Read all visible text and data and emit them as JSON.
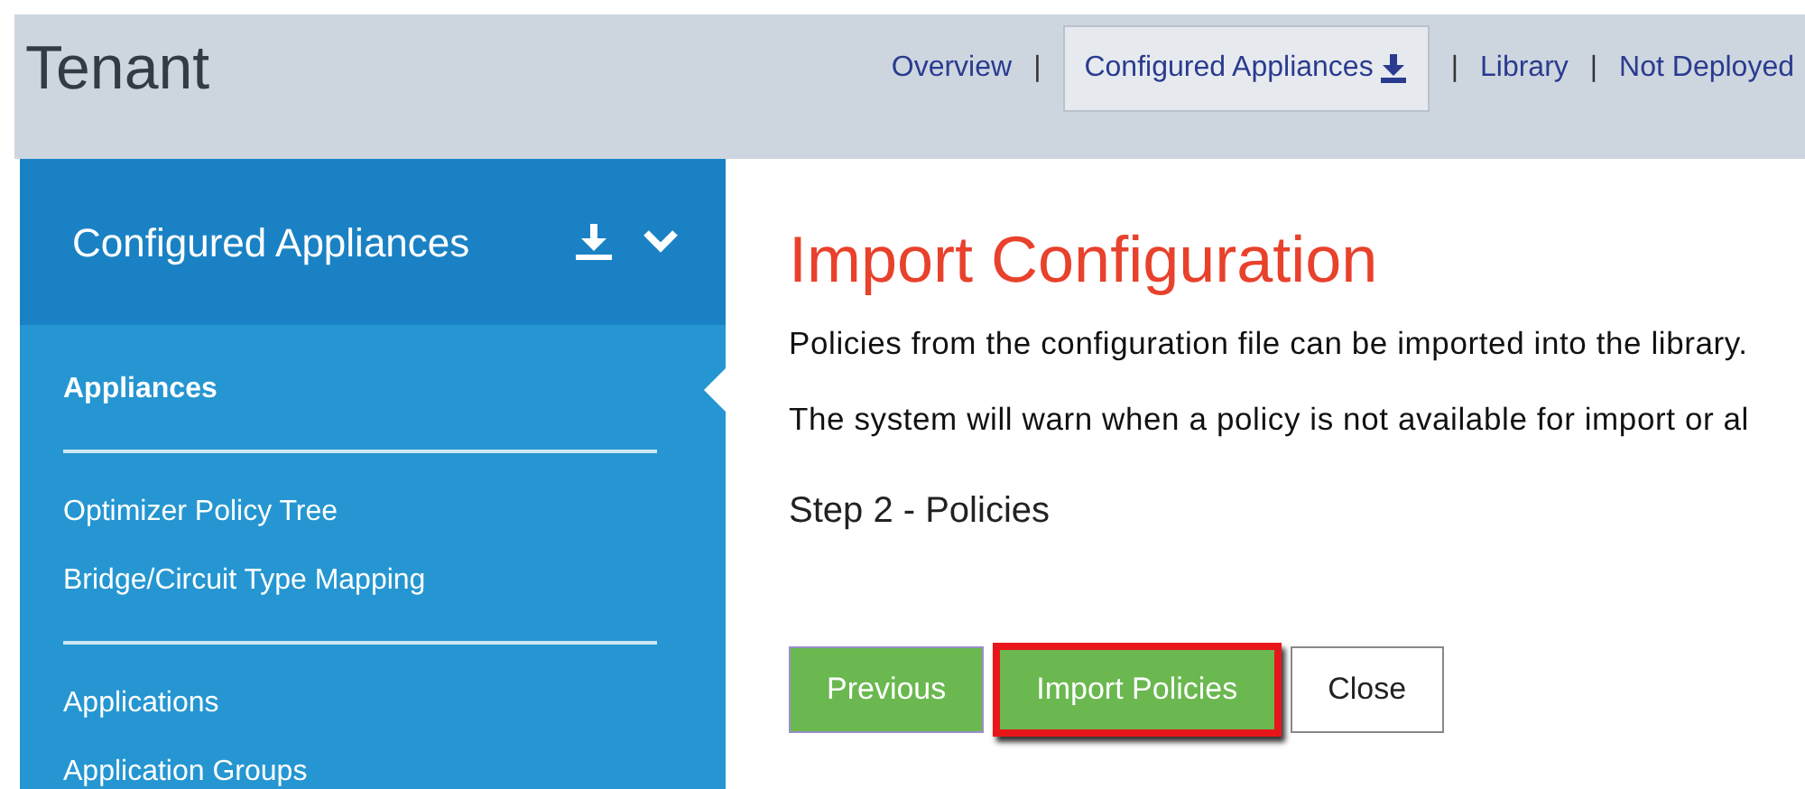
{
  "header": {
    "title": "Tenant",
    "nav": [
      {
        "label": "Overview",
        "selected": false,
        "download": false
      },
      {
        "separator": "|",
        "label": "Configured Appliances",
        "selected": true,
        "download": true
      },
      {
        "separator": "|",
        "label": "Library",
        "selected": false,
        "download": false
      },
      {
        "separator": "|",
        "label": "Not Deployed",
        "selected": false,
        "download": false
      }
    ]
  },
  "sidebar": {
    "title": "Configured Appliances",
    "expanded": true,
    "groups": [
      {
        "items": [
          {
            "label": "Appliances",
            "selected": true
          }
        ]
      },
      {
        "items": [
          {
            "label": "Optimizer Policy Tree",
            "selected": false
          },
          {
            "label": "Bridge/Circuit Type Mapping",
            "selected": false
          }
        ]
      },
      {
        "items": [
          {
            "label": "Applications",
            "selected": false
          },
          {
            "label": "Application Groups",
            "selected": false
          }
        ]
      }
    ]
  },
  "main": {
    "heading": "Import Configuration",
    "paragraphs": [
      "Policies from the configuration file can be imported into the library.",
      "The system will warn when a policy is not available for import or al"
    ],
    "step": "Step 2 - Policies",
    "buttons": [
      {
        "label": "Previous",
        "kind": "primary",
        "highlighted": false
      },
      {
        "label": "Import Policies",
        "kind": "primary",
        "highlighted": true
      },
      {
        "label": "Close",
        "kind": "secondary",
        "highlighted": false
      }
    ]
  }
}
